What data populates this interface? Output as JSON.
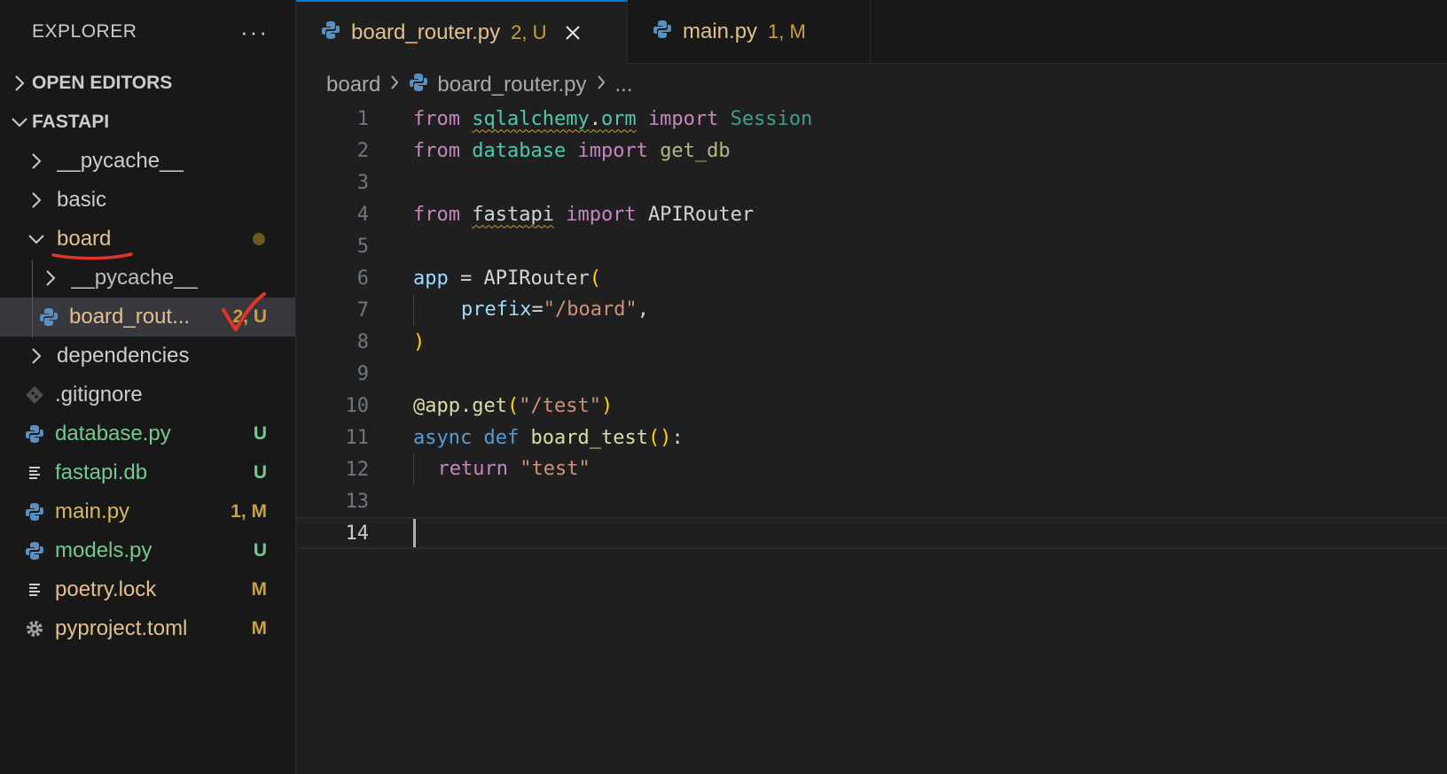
{
  "explorer": {
    "title": "EXPLORER",
    "more": "···",
    "open_editors": "OPEN EDITORS",
    "project": "FASTAPI"
  },
  "tree": [
    {
      "name": "__pycache__",
      "type": "folder",
      "expanded": false
    },
    {
      "name": "basic",
      "type": "folder",
      "expanded": false
    },
    {
      "name": "board",
      "type": "folder",
      "expanded": true
    },
    {
      "name": "__pycache__",
      "type": "folder",
      "expanded": false
    },
    {
      "name": "board_rout...",
      "type": "python",
      "badge": "2, U"
    },
    {
      "name": "dependencies",
      "type": "folder",
      "expanded": false
    },
    {
      "name": ".gitignore",
      "type": "git"
    },
    {
      "name": "database.py",
      "type": "python",
      "badge": "U"
    },
    {
      "name": "fastapi.db",
      "type": "text",
      "badge": "U"
    },
    {
      "name": "main.py",
      "type": "python",
      "badge": "1, M"
    },
    {
      "name": "models.py",
      "type": "python",
      "badge": "U"
    },
    {
      "name": "poetry.lock",
      "type": "text",
      "badge": "M"
    },
    {
      "name": "pyproject.toml",
      "type": "gear",
      "badge": "M"
    }
  ],
  "tabs": [
    {
      "label": "board_router.py",
      "status": "2, U"
    },
    {
      "label": "main.py",
      "status": "1, M"
    }
  ],
  "breadcrumb": {
    "folder": "board",
    "file": "board_router.py",
    "symbol": "..."
  },
  "code": {
    "line_numbers": [
      "1",
      "2",
      "3",
      "4",
      "5",
      "6",
      "7",
      "8",
      "9",
      "10",
      "11",
      "12",
      "13",
      "14"
    ],
    "l1": {
      "from": "from",
      "mod1": "sqlalchemy",
      "dot": ".",
      "mod2": "orm",
      "imp": "import",
      "name": "Session"
    },
    "l2": {
      "from": "from",
      "mod": "database",
      "imp": "import",
      "name": "get_db"
    },
    "l4": {
      "from": "from",
      "mod": "fastapi",
      "imp": "import",
      "name": "APIRouter"
    },
    "l6": {
      "var": "app",
      "eq": " = ",
      "cls": "APIRouter",
      "open": "("
    },
    "l7": {
      "param": "prefix",
      "eq": "=",
      "str": "\"/board\"",
      "comma": ","
    },
    "l8": {
      "close": ")"
    },
    "l10": {
      "at": "@app",
      "dot": ".",
      "fn": "get",
      "open": "(",
      "str": "\"/test\"",
      "close": ")"
    },
    "l11": {
      "async": "async",
      "def": "def",
      "fn": "board_test",
      "parens": "()",
      "colon": ":"
    },
    "l12": {
      "ret": "return",
      "str": "\"test\""
    }
  }
}
